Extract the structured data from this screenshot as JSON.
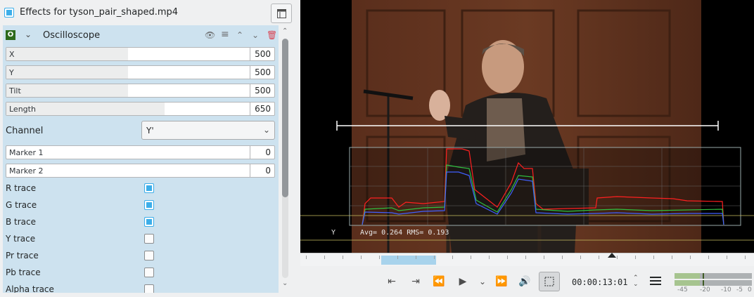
{
  "effects": {
    "title": "Effects for tyson_pair_shaped.mp4",
    "effect": {
      "badge": "O",
      "name": "Oscilloscope",
      "params": [
        {
          "label": "X",
          "value": "500",
          "fraction": 0.5
        },
        {
          "label": "Y",
          "value": "500",
          "fraction": 0.5
        },
        {
          "label": "Tilt",
          "value": "500",
          "fraction": 0.5
        },
        {
          "label": "Length",
          "value": "650",
          "fraction": 0.65
        }
      ],
      "channel_label": "Channel",
      "channel_value": "Y'",
      "markers": [
        {
          "label": "Marker 1",
          "value": "0",
          "fraction": 0
        },
        {
          "label": "Marker 2",
          "value": "0",
          "fraction": 0
        }
      ],
      "traces": [
        {
          "label": "R trace",
          "checked": true
        },
        {
          "label": "G trace",
          "checked": true
        },
        {
          "label": "B trace",
          "checked": true
        },
        {
          "label": "Y trace",
          "checked": false
        },
        {
          "label": "Pr trace",
          "checked": false
        },
        {
          "label": "Pb trace",
          "checked": false
        },
        {
          "label": "Alpha trace",
          "checked": false
        }
      ]
    }
  },
  "monitor": {
    "overlay_channel": "Y",
    "overlay_stats": "Avg= 0.264 RMS= 0.193",
    "timecode": "00:00:13:01",
    "meter_scale": [
      "-45",
      "-20",
      "-10",
      "-5",
      "0"
    ]
  },
  "colors": {
    "accent": "#3daee9",
    "panel": "#cde2ef",
    "trace_r": "#ff2020",
    "trace_g": "#30c040",
    "trace_b": "#4060ff"
  }
}
